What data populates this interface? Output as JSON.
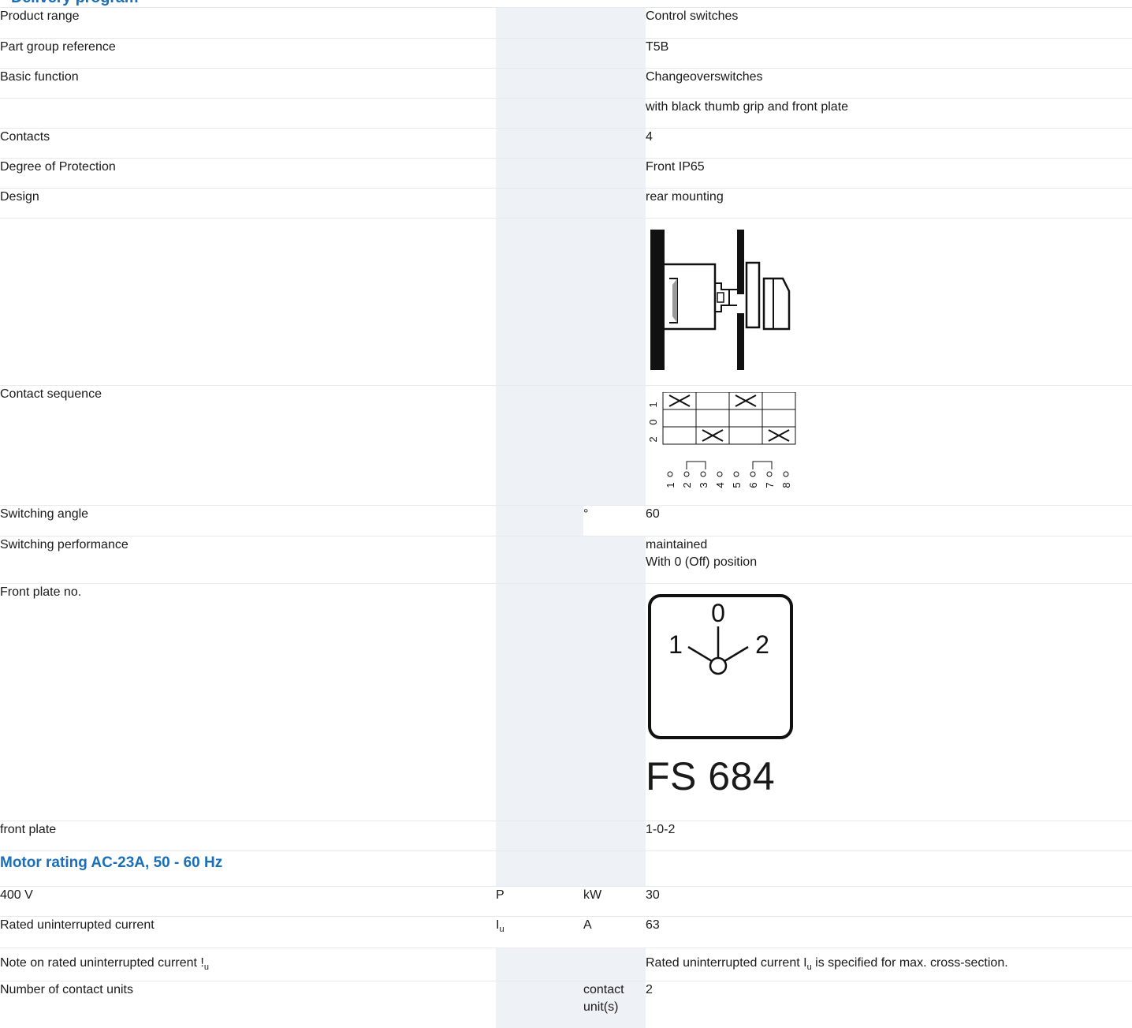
{
  "section_heading": "Delivery program",
  "rows": {
    "product_range": {
      "label": "Product range",
      "value": "Control switches"
    },
    "part_group": {
      "label": "Part group reference",
      "value": "T5B"
    },
    "basic_function": {
      "label": "Basic function",
      "value": "Changeoverswitches"
    },
    "basic_function_note": {
      "value": "with black thumb grip and front plate"
    },
    "contacts": {
      "label": "Contacts",
      "value": "4"
    },
    "protection": {
      "label": "Degree of Protection",
      "value": "Front IP65"
    },
    "design": {
      "label": "Design",
      "value": "rear mounting"
    },
    "contact_sequence": {
      "label": "Contact sequence",
      "positions": [
        "1",
        "0",
        "2"
      ],
      "terminals": [
        "1",
        "2",
        "3",
        "4",
        "5",
        "6",
        "7",
        "8"
      ]
    },
    "switching_angle": {
      "label": "Switching angle",
      "unit": "°",
      "value": "60"
    },
    "switching_performance": {
      "label": "Switching performance",
      "value_line1": "maintained",
      "value_line2": "With 0 (Off) position"
    },
    "front_plate_no": {
      "label": "Front plate no.",
      "dial_labels": {
        "top": "0",
        "left": "1",
        "right": "2"
      },
      "code": "FS 684"
    },
    "front_plate": {
      "label": "front plate",
      "value": "1-0-2"
    },
    "motor_section": {
      "title": "Motor rating AC-23A, 50 - 60 Hz"
    },
    "motor_400v": {
      "label": "400 V",
      "symbol": "P",
      "unit": "kW",
      "value": "30"
    },
    "rated_current": {
      "label": "Rated uninterrupted current",
      "symbol": "I",
      "symbol_sub": "u",
      "unit": "A",
      "value": "63"
    },
    "note_current": {
      "label": "Note on rated uninterrupted current !",
      "label_sub": "u",
      "value_pre": "Rated uninterrupted current I",
      "value_sub": "u",
      "value_post": " is specified for max. cross-section."
    },
    "contact_units": {
      "label": "Number of contact units",
      "unit_line1": "contact",
      "unit_line2": "unit(s)",
      "value": "2"
    }
  }
}
